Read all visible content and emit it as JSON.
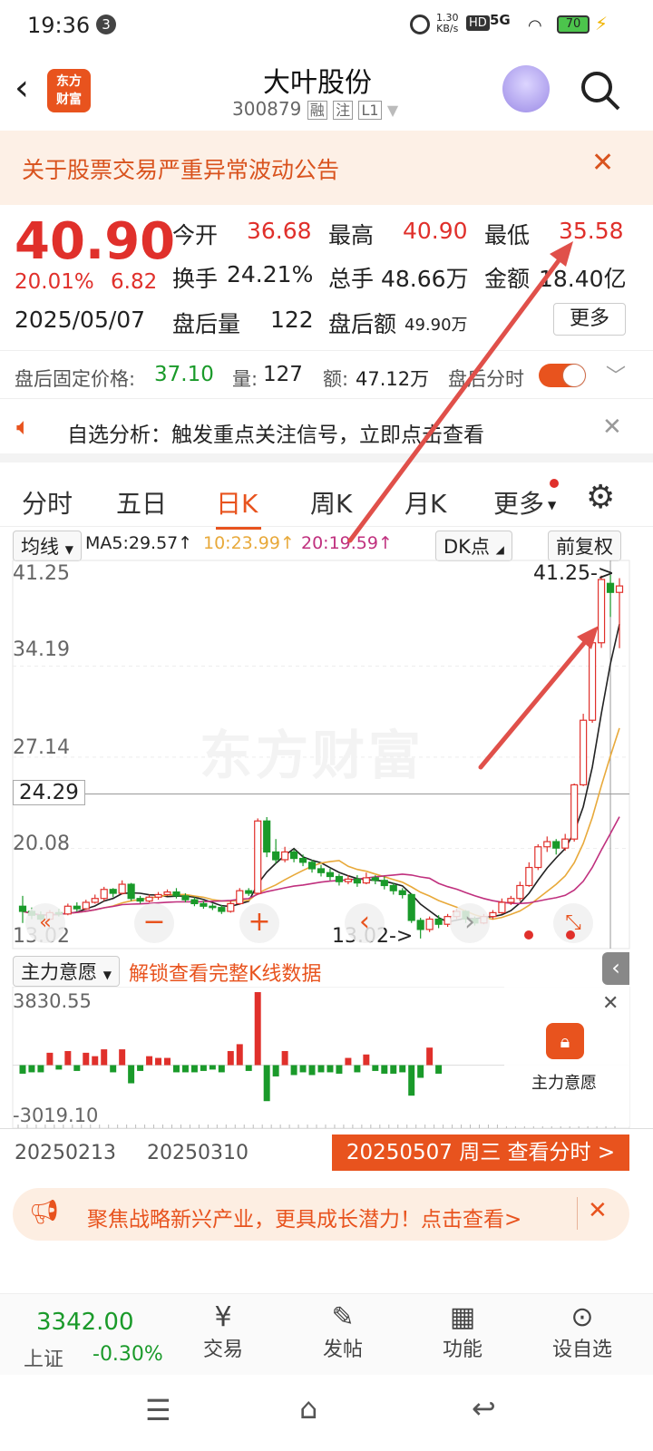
{
  "status": {
    "time": "19:36",
    "notif_count": "3",
    "net_speed_top": "1.30",
    "net_speed_bottom": "KB/s",
    "hd": "HD",
    "signal": "5G",
    "battery": "70"
  },
  "header": {
    "stock_name": "大叶股份",
    "code": "300879",
    "tags": [
      "融",
      "注",
      "L1"
    ],
    "logo_line1": "东方",
    "logo_line2": "财富"
  },
  "notice": {
    "text": "关于股票交易严重异常波动公告"
  },
  "quote": {
    "price": "40.90",
    "change_pct": "20.01%",
    "change": "6.82",
    "date": "2025/05/07",
    "open_label": "今开",
    "open": "36.68",
    "high_label": "最高",
    "high": "40.90",
    "low_label": "最低",
    "low": "35.58",
    "turnover_label": "换手",
    "turnover": "24.21%",
    "volume_label": "总手",
    "volume": "48.66万",
    "amount_label": "金额",
    "amount": "18.40亿",
    "after_vol_label": "盘后量",
    "after_vol": "122",
    "after_amt_label": "盘后额",
    "after_amt": "49.90万",
    "more_label": "更多"
  },
  "fixed": {
    "label": "盘后固定价格:",
    "price": "37.10",
    "vol_label": "量:",
    "vol": "127",
    "amt_label": "额:",
    "amt": "47.12万",
    "toggle_label": "盘后分时"
  },
  "analysis": {
    "text": "自选分析：触发重点关注信号，立即点击查看"
  },
  "tabs": [
    "分时",
    "五日",
    "日K",
    "周K",
    "月K",
    "更多"
  ],
  "ma": {
    "selector": "均线",
    "ma5": "MA5:29.57↑",
    "ma10": "10:23.99↑",
    "ma20": "20:19.59↑",
    "dk": "DK点",
    "fq": "前复权"
  },
  "kchart": {
    "y_labels": [
      "41.25",
      "34.19",
      "27.14",
      "20.08",
      "13.02"
    ],
    "crosshair_price": "24.29",
    "max_label": "41.25->",
    "min_label": "13.02->",
    "watermark": "东方财富"
  },
  "chart_data": {
    "type": "candlestick",
    "ylim": [
      13.02,
      41.25
    ],
    "candles": [
      [
        15.6,
        15.2,
        16.4,
        14.3
      ],
      [
        15.2,
        14.9,
        15.5,
        14.6
      ],
      [
        14.9,
        14.6,
        15.2,
        14.4
      ],
      [
        14.6,
        15.1,
        15.3,
        14.5
      ],
      [
        15.1,
        15.0,
        15.4,
        14.8
      ],
      [
        15.0,
        15.6,
        15.8,
        14.9
      ],
      [
        15.6,
        15.4,
        15.9,
        15.2
      ],
      [
        15.4,
        15.9,
        16.1,
        15.3
      ],
      [
        15.9,
        16.2,
        16.5,
        15.8
      ],
      [
        16.2,
        16.9,
        17.1,
        16.0
      ],
      [
        16.9,
        16.6,
        17.0,
        16.3
      ],
      [
        16.6,
        17.3,
        17.6,
        16.5
      ],
      [
        17.3,
        16.2,
        17.4,
        16.0
      ],
      [
        16.2,
        16.0,
        16.4,
        15.8
      ],
      [
        16.0,
        16.3,
        16.5,
        15.9
      ],
      [
        16.3,
        16.5,
        16.7,
        16.1
      ],
      [
        16.5,
        16.7,
        16.9,
        16.4
      ],
      [
        16.7,
        16.4,
        17.0,
        16.2
      ],
      [
        16.4,
        16.1,
        16.6,
        15.9
      ],
      [
        16.1,
        15.8,
        16.3,
        15.6
      ],
      [
        15.8,
        15.6,
        16.0,
        15.4
      ],
      [
        15.6,
        15.5,
        15.8,
        15.3
      ],
      [
        15.5,
        15.2,
        15.7,
        15.0
      ],
      [
        15.2,
        15.8,
        16.0,
        15.1
      ],
      [
        15.8,
        16.8,
        17.0,
        15.7
      ],
      [
        16.8,
        16.6,
        17.0,
        16.4
      ],
      [
        16.6,
        22.2,
        22.4,
        16.5
      ],
      [
        22.2,
        19.8,
        22.5,
        19.4
      ],
      [
        19.8,
        19.2,
        20.8,
        18.9
      ],
      [
        19.2,
        19.8,
        20.2,
        19.0
      ],
      [
        19.8,
        19.3,
        20.0,
        19.0
      ],
      [
        19.3,
        19.0,
        19.6,
        18.7
      ],
      [
        19.0,
        18.5,
        19.2,
        18.2
      ],
      [
        18.5,
        18.2,
        18.8,
        17.9
      ],
      [
        18.2,
        17.9,
        18.5,
        17.6
      ],
      [
        17.9,
        17.5,
        18.1,
        17.2
      ],
      [
        17.5,
        17.7,
        18.0,
        17.3
      ],
      [
        17.7,
        17.4,
        18.0,
        17.1
      ],
      [
        17.4,
        17.8,
        18.2,
        17.3
      ],
      [
        17.8,
        17.6,
        18.0,
        17.3
      ],
      [
        17.6,
        17.2,
        17.9,
        16.9
      ],
      [
        17.2,
        16.8,
        17.4,
        16.5
      ],
      [
        16.8,
        16.5,
        17.0,
        16.2
      ],
      [
        16.5,
        14.5,
        16.6,
        14.3
      ],
      [
        14.5,
        13.8,
        14.7,
        13.1
      ],
      [
        13.8,
        14.6,
        14.8,
        13.6
      ],
      [
        14.6,
        14.2,
        14.9,
        13.9
      ],
      [
        14.2,
        14.8,
        15.0,
        14.0
      ],
      [
        14.8,
        15.2,
        15.4,
        14.6
      ],
      [
        15.2,
        14.6,
        15.3,
        14.3
      ],
      [
        14.6,
        14.3,
        14.8,
        14.1
      ],
      [
        14.3,
        14.8,
        15.0,
        14.2
      ],
      [
        14.8,
        15.1,
        15.3,
        14.6
      ],
      [
        15.1,
        15.9,
        16.2,
        15.0
      ],
      [
        15.9,
        16.2,
        16.4,
        15.7
      ],
      [
        16.2,
        17.2,
        17.5,
        16.0
      ],
      [
        17.2,
        18.6,
        19.0,
        17.1
      ],
      [
        18.6,
        20.2,
        20.4,
        18.4
      ],
      [
        20.2,
        20.6,
        21.0,
        19.8
      ],
      [
        20.6,
        20.1,
        20.8,
        19.6
      ],
      [
        20.1,
        20.8,
        21.2,
        19.9
      ],
      [
        20.8,
        25.0,
        25.1,
        20.6
      ],
      [
        25.0,
        30.0,
        30.5,
        24.9
      ],
      [
        30.0,
        36.0,
        36.2,
        29.8
      ],
      [
        36.0,
        40.9,
        41.2,
        35.6
      ],
      [
        40.6,
        39.9,
        41.25,
        38.0
      ],
      [
        39.9,
        40.4,
        41.0,
        35.58
      ]
    ],
    "volume_ylim": [
      -3019.1,
      3830.55
    ],
    "volume_labels": [
      "3830.55",
      "-3019.10"
    ],
    "dates": [
      "20250213",
      "20250310"
    ]
  },
  "flow": {
    "selector": "主力意愿",
    "unlock_text": "解锁查看完整K线数据",
    "card_label": "主力意愿",
    "date_banner": "20250507 周三 查看分时 >"
  },
  "promo": {
    "text": "聚焦战略新兴产业，更具成长潜力！点击查看>"
  },
  "bottom": {
    "index_value": "3342.00",
    "index_name": "上证",
    "index_change": "-0.30%",
    "items": [
      "交易",
      "发帖",
      "功能",
      "设自选"
    ]
  },
  "colors": {
    "up": "#e0302b",
    "down": "#1a9a2a",
    "accent": "#e8531e",
    "ma5": "#222222",
    "ma10": "#e8a93a",
    "ma20": "#c0307e"
  }
}
